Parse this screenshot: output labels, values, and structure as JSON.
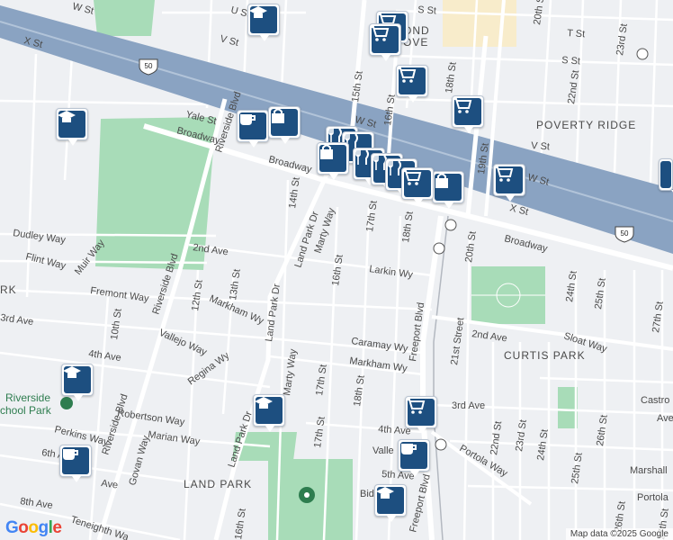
{
  "map": {
    "attribution": "Map data ©2025 Google",
    "logo_text": "Google",
    "neighborhoods": {
      "poverty_ridge": "POVERTY RIDGE",
      "curtis_park": "CURTIS PARK",
      "land_park": "LAND PARK",
      "richmond_grove_partial": "OND\nOVE",
      "west_partial": "RK"
    },
    "parks": {
      "riverside_school_park": "Riverside\nSchool Park"
    },
    "highway_shield": "50",
    "streets": {
      "w_st": "W St",
      "x_st": "X St",
      "u_st": "U St",
      "s_st": "S St",
      "v_st": "V St",
      "t_st": "T St",
      "yale_st": "Yale St",
      "broadway": "Broadway",
      "riverside_blvd": "Riverside Blvd",
      "land_park_dr": "Land Park Dr",
      "marty_way": "Marty Way",
      "freeport_blvd": "Freeport Blvd",
      "twenty_first_street": "21st Street",
      "second_ave": "2nd Ave",
      "third_ave": "3rd Ave",
      "fourth_ave": "4th Ave",
      "fifth_ave": "5th Ave",
      "sixth_ave": "6th Ave",
      "eighth_ave": "8th Ave",
      "larkin_wy": "Larkin Wy",
      "markham_wy": "Markham Wy",
      "caramay_wy": "Caramay Wy",
      "fremont_way": "Fremont Way",
      "dudley_way": "Dudley Way",
      "flint_way": "Flint Way",
      "muir_way": "Muir Way",
      "vallejo_way": "Vallejo Way",
      "regina_wy": "Regina Wy",
      "robertson_way": "Robertson Way",
      "marian_way": "Marian Way",
      "perkins_way": "Perkins Way",
      "govan_way": "Govan Way",
      "teneighth_way": "Teneighth Wa",
      "portola_way": "Portola Way",
      "sloat_way": "Sloat Way",
      "castro": "Castro",
      "marshall": "Marshall",
      "portola": "Portola",
      "bid": "Bid",
      "valle": "Valle",
      "ave_partial": "Ave",
      "tenth_st": "10th St",
      "twelfth_st": "12th St",
      "thirteenth_st": "13th St",
      "fourteenth_st": "14th St",
      "fifteenth_st": "15th St",
      "sixteenth_st": "16th St",
      "seventeenth_st": "17th St",
      "eighteenth_st": "18th St",
      "nineteenth_st": "19th St",
      "twentieth_st": "20th St",
      "twentysecond_st": "22nd St",
      "twentythird_st": "23rd St",
      "twentyfourth_st": "24th St",
      "twentyfifth_st": "25th St",
      "twentysixth_st": "26th St",
      "twentyseventh_st": "27th St"
    }
  },
  "markers": [
    {
      "name": "school-marker-top",
      "icon": "school-icon"
    },
    {
      "name": "school-marker-west",
      "icon": "school-icon"
    },
    {
      "name": "school-marker-riverside",
      "icon": "school-icon"
    },
    {
      "name": "school-marker-landpark",
      "icon": "school-icon"
    },
    {
      "name": "school-marker-south",
      "icon": "school-icon"
    },
    {
      "name": "cafe-marker-yale",
      "icon": "coffee-cup-icon"
    },
    {
      "name": "cafe-marker-sixth",
      "icon": "coffee-cup-icon"
    },
    {
      "name": "cafe-marker-freeport",
      "icon": "coffee-cup-icon"
    },
    {
      "name": "store-marker-yale",
      "icon": "shopping-bag-icon"
    },
    {
      "name": "store-marker-broadway",
      "icon": "shopping-bag-icon"
    },
    {
      "name": "store-marker-cluster",
      "icon": "shopping-bag-icon"
    },
    {
      "name": "grocery-marker-top",
      "icon": "shopping-cart-icon"
    },
    {
      "name": "grocery-marker-richmond",
      "icon": "shopping-cart-icon"
    },
    {
      "name": "grocery-marker-t-st",
      "icon": "shopping-cart-icon"
    },
    {
      "name": "grocery-marker-v-st",
      "icon": "shopping-cart-icon"
    },
    {
      "name": "grocery-marker-19th",
      "icon": "shopping-cart-icon"
    },
    {
      "name": "grocery-marker-x-st",
      "icon": "shopping-cart-icon"
    },
    {
      "name": "grocery-marker-freeport",
      "icon": "shopping-cart-icon"
    },
    {
      "name": "restaurant-marker-cluster-1",
      "icon": "fork-knife-icon"
    },
    {
      "name": "restaurant-marker-cluster-2",
      "icon": "fork-knife-icon"
    },
    {
      "name": "restaurant-marker-cluster-3",
      "icon": "fork-knife-icon"
    }
  ],
  "colors": {
    "freeway": "#8aa3c2",
    "park": "#a8dcb8",
    "marker": "#1d4f80",
    "highlight_zone": "#f8eccb"
  }
}
